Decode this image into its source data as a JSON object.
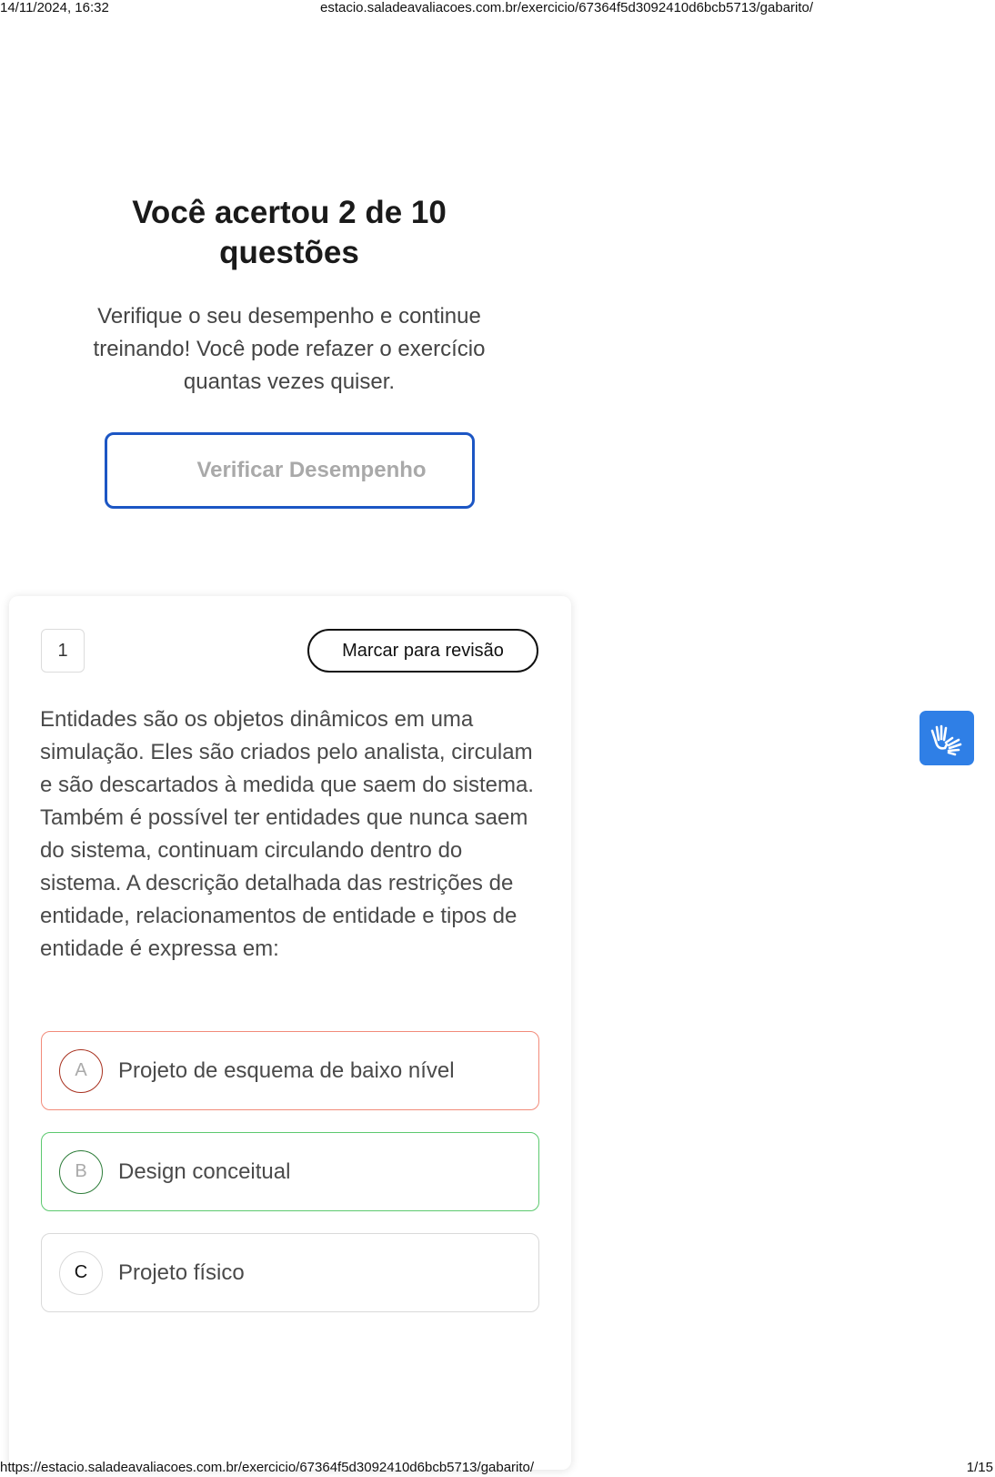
{
  "print_header": {
    "datetime": "14/11/2024, 16:32",
    "url": "estacio.saladeavaliacoes.com.br/exercicio/67364f5d3092410d6bcb5713/gabarito/"
  },
  "print_footer": {
    "url": "https://estacio.saladeavaliacoes.com.br/exercicio/67364f5d3092410d6bcb5713/gabarito/",
    "page": "1/15"
  },
  "result": {
    "title": "Você acertou 2 de 10 questões",
    "subtitle": "Verifique o seu desempenho e continue treinando! Você pode refazer o exercício quantas vezes quiser.",
    "verify_button_label": "Verificar Desempenho"
  },
  "question": {
    "number": "1",
    "review_button_label": "Marcar para revisão",
    "text": "Entidades são os objetos dinâmicos em uma simulação. Eles são criados pelo analista, circulam e são descartados à medida que saem do sistema. Também é possível ter entidades que nunca saem do sistema, continuam circulando dentro do sistema. A descrição detalhada das restrições de entidade, relacionamentos de entidade e tipos de entidade é expressa em:",
    "options": [
      {
        "letter": "A",
        "text": "Projeto de esquema de baixo nível",
        "state": "wrong"
      },
      {
        "letter": "B",
        "text": "Design conceitual",
        "state": "correct"
      },
      {
        "letter": "C",
        "text": "Projeto físico",
        "state": "neutral"
      }
    ]
  },
  "accessibility_widget": {
    "icon": "sign-language-hands-icon",
    "color": "#2f7fe6"
  },
  "colors": {
    "accent_blue": "#1c56c4",
    "wrong_border": "#f28b7a",
    "correct_border": "#5cc96f"
  }
}
